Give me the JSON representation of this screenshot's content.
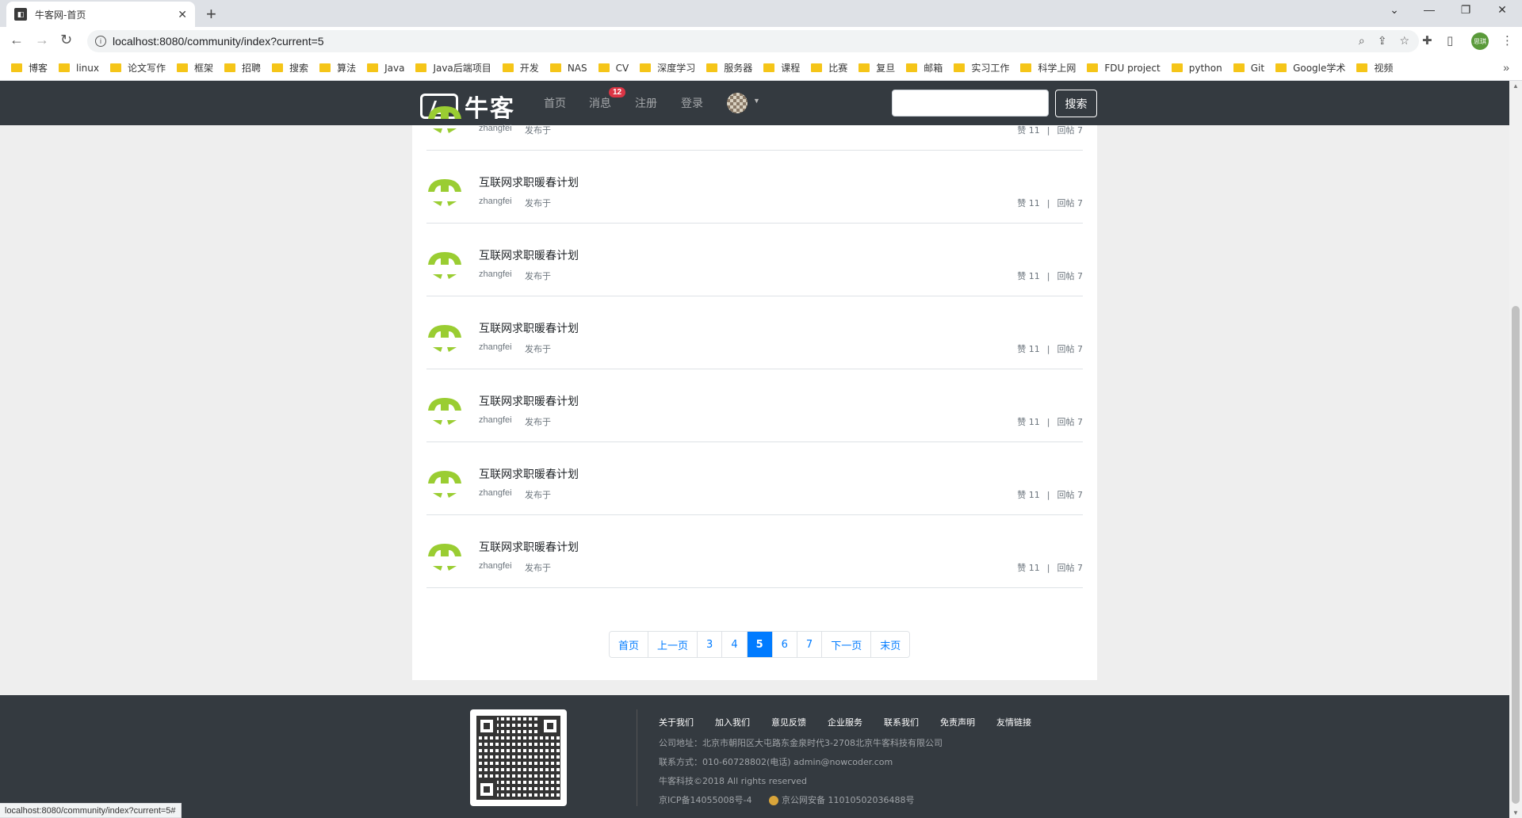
{
  "browser": {
    "tab_title": "牛客网-首页",
    "url": "localhost:8080/community/index?current=5",
    "profile_label": "思琪",
    "status_url": "localhost:8080/community/index?current=5#",
    "bookmarks": [
      "博客",
      "linux",
      "论文写作",
      "框架",
      "招聘",
      "搜索",
      "算法",
      "Java",
      "Java后端项目",
      "开发",
      "NAS",
      "CV",
      "深度学习",
      "服务器",
      "课程",
      "比赛",
      "复旦",
      "邮箱",
      "实习工作",
      "科学上网",
      "FDU project",
      "python",
      "Git",
      "Google学术",
      "视频"
    ]
  },
  "header": {
    "logo_text": "牛客",
    "nav": {
      "home": "首页",
      "messages": "消息",
      "register": "注册",
      "login": "登录"
    },
    "message_badge": "12",
    "search_placeholder": "",
    "search_button": "搜索"
  },
  "posts": [
    {
      "title": "",
      "author": "zhangfei",
      "published": "发布于",
      "likes": "赞 11",
      "replies": "回帖 7"
    },
    {
      "title": "互联网求职暖春计划",
      "author": "zhangfei",
      "published": "发布于",
      "likes": "赞 11",
      "replies": "回帖 7"
    },
    {
      "title": "互联网求职暖春计划",
      "author": "zhangfei",
      "published": "发布于",
      "likes": "赞 11",
      "replies": "回帖 7"
    },
    {
      "title": "互联网求职暖春计划",
      "author": "zhangfei",
      "published": "发布于",
      "likes": "赞 11",
      "replies": "回帖 7"
    },
    {
      "title": "互联网求职暖春计划",
      "author": "zhangfei",
      "published": "发布于",
      "likes": "赞 11",
      "replies": "回帖 7"
    },
    {
      "title": "互联网求职暖春计划",
      "author": "zhangfei",
      "published": "发布于",
      "likes": "赞 11",
      "replies": "回帖 7"
    },
    {
      "title": "互联网求职暖春计划",
      "author": "zhangfei",
      "published": "发布于",
      "likes": "赞 11",
      "replies": "回帖 7"
    }
  ],
  "pagination": {
    "items": [
      "首页",
      "上一页",
      "3",
      "4",
      "5",
      "6",
      "7",
      "下一页",
      "末页"
    ],
    "current": "5"
  },
  "footer": {
    "links": [
      "关于我们",
      "加入我们",
      "意见反馈",
      "企业服务",
      "联系我们",
      "免责声明",
      "友情链接"
    ],
    "address": "公司地址：北京市朝阳区大屯路东金泉时代3-2708北京牛客科技有限公司",
    "contact": "联系方式：010-60728802(电话)    admin@nowcoder.com",
    "copyright": "牛客科技©2018 All rights reserved",
    "icp": "京ICP备14055008号-4",
    "police": "京公网安备 11010502036488号"
  },
  "colors": {
    "header_bg": "#343a40",
    "accent": "#007bff",
    "badge": "#dc3545",
    "avatar_green": "#9acd32"
  }
}
